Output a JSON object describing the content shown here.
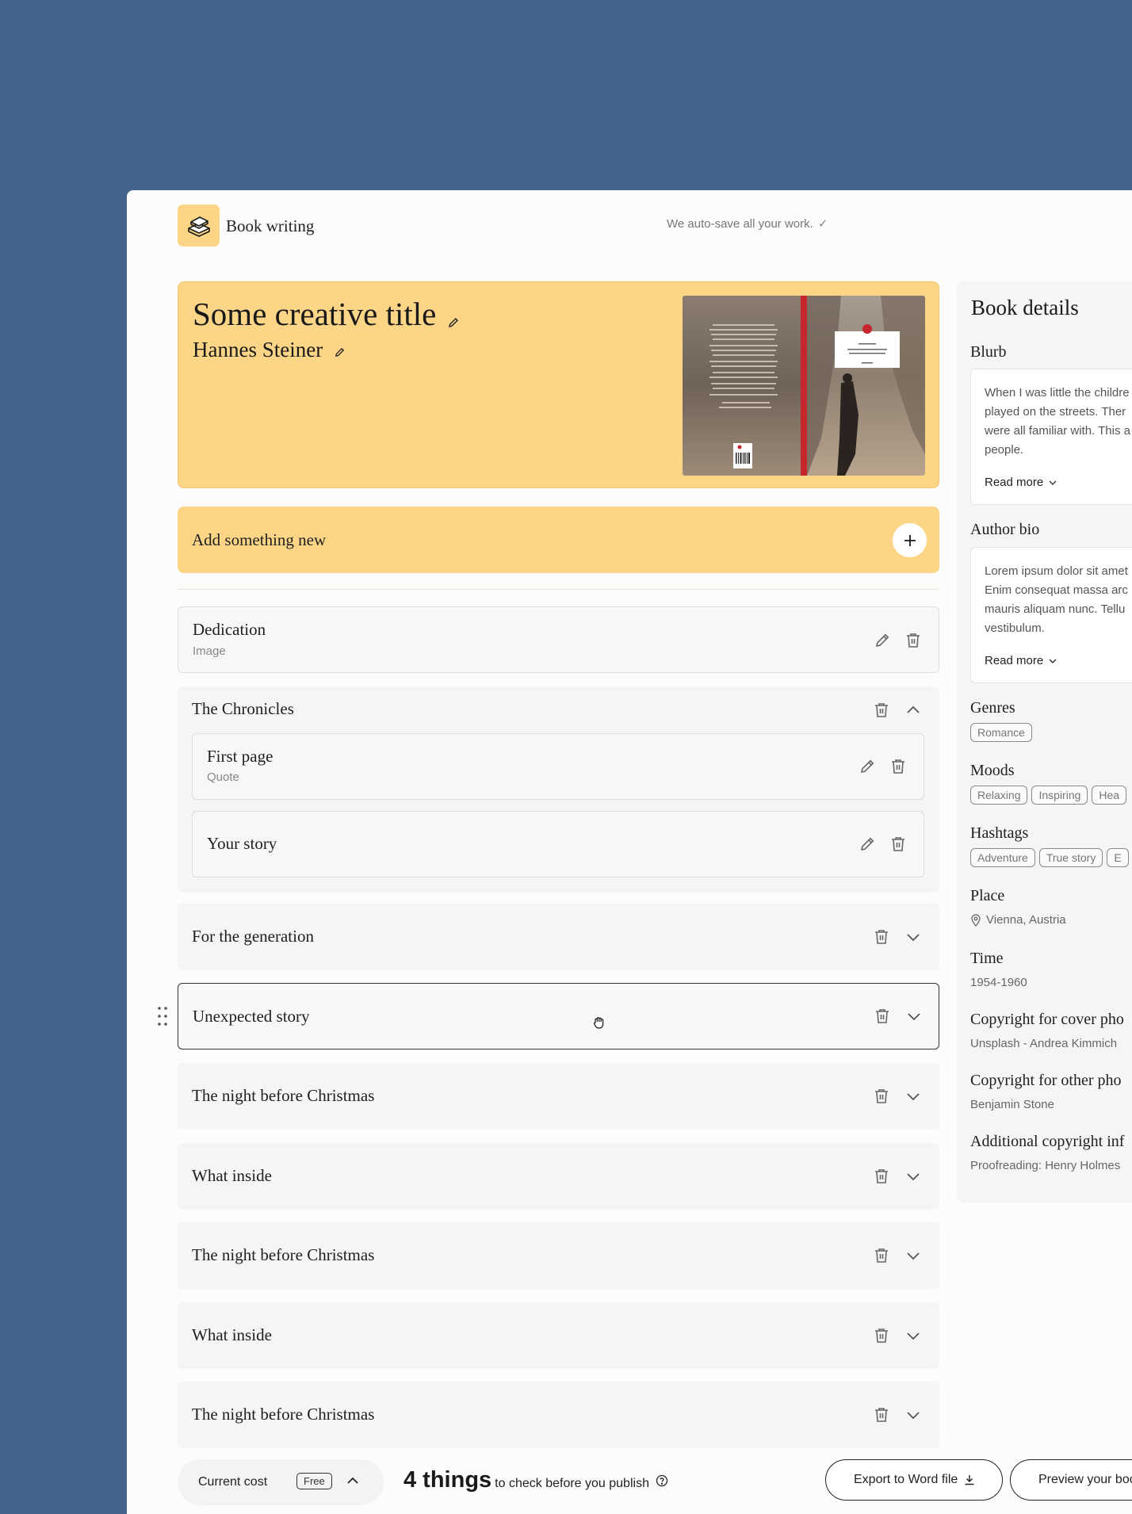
{
  "header": {
    "app_title": "Book writing",
    "autosave": "We auto-save all your work."
  },
  "hero": {
    "title": "Some creative title",
    "author": "Hannes Steiner"
  },
  "add_new": {
    "label": "Add something new"
  },
  "sections": {
    "dedication": {
      "title": "Dedication",
      "subtitle": "Image"
    },
    "chronicles": {
      "title": "The Chronicles",
      "children": [
        {
          "title": "First page",
          "subtitle": "Quote"
        },
        {
          "title": "Your story",
          "subtitle": ""
        }
      ]
    },
    "list": [
      {
        "title": "For the generation"
      },
      {
        "title": "Unexpected story"
      },
      {
        "title": "The night before Christmas"
      },
      {
        "title": "What inside"
      },
      {
        "title": "The night before Christmas"
      },
      {
        "title": "What inside"
      },
      {
        "title": "The night before Christmas"
      }
    ]
  },
  "details": {
    "title": "Book details",
    "blurb": {
      "label": "Blurb",
      "text": "When I was little the childre played on the streets. Ther were all familiar with. This a people.",
      "read_more": "Read more"
    },
    "author_bio": {
      "label": "Author bio",
      "text": "Lorem ipsum dolor sit amet Enim consequat massa arc mauris aliquam nunc. Tellu vestibulum.",
      "read_more": "Read more"
    },
    "genres": {
      "label": "Genres",
      "chips": [
        "Romance"
      ]
    },
    "moods": {
      "label": "Moods",
      "chips": [
        "Relaxing",
        "Inspiring",
        "Hea"
      ]
    },
    "hashtags": {
      "label": "Hashtags",
      "chips": [
        "Adventure",
        "True story",
        "E"
      ]
    },
    "place": {
      "label": "Place",
      "value": "Vienna, Austria"
    },
    "time": {
      "label": "Time",
      "value": "1954-1960"
    },
    "copyright_cover": {
      "label": "Copyright for cover pho",
      "value": "Unsplash - Andrea Kimmich"
    },
    "copyright_other": {
      "label": "Copyright for other pho",
      "value": "Benjamin Stone"
    },
    "additional": {
      "label": "Additional copyright inf",
      "value": "Proofreading: Henry Holmes"
    }
  },
  "footer": {
    "cost_label": "Current cost",
    "cost_badge": "Free",
    "things_count": "4 things",
    "things_text": "to check before you publish",
    "export_label": "Export to Word file",
    "preview_label": "Preview your boo"
  },
  "colors": {
    "background": "#43638a",
    "accent": "#fdd587",
    "surface": "#f5f5f4"
  }
}
